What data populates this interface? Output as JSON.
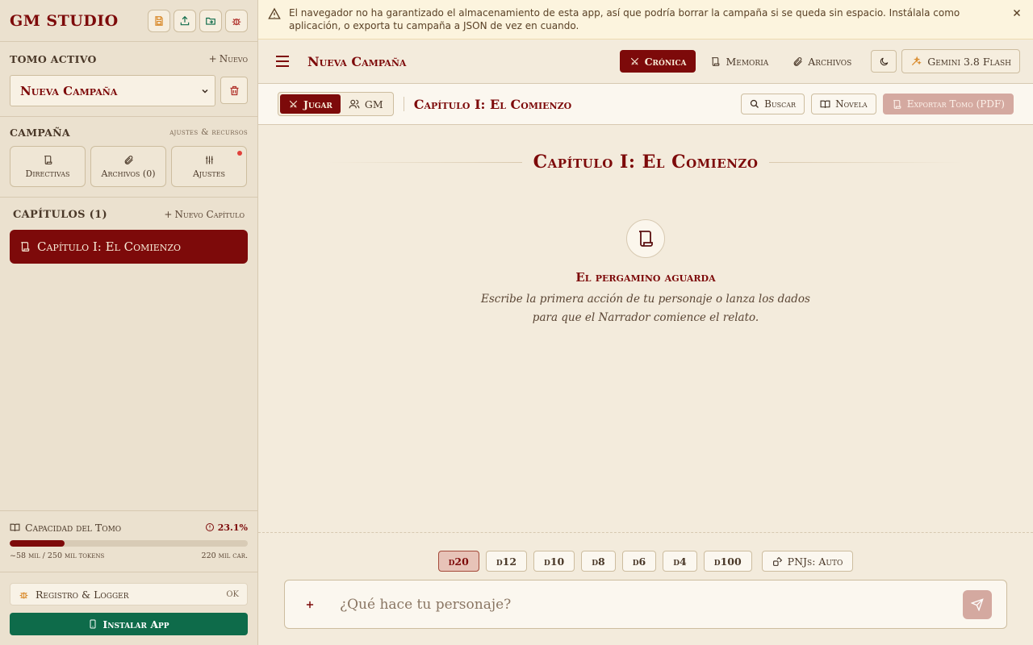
{
  "sidebar": {
    "brand": "GM STUDIO",
    "tomo_label": "TOMO ACTIVO",
    "new_label": "Nuevo",
    "tomo_selected": "Nueva Campaña",
    "campaign_label": "CAMPAÑA",
    "campaign_sub": "ajustes & recursos",
    "cards": [
      {
        "label": "Directivas",
        "icon": "scroll-icon"
      },
      {
        "label": "Archivos (0)",
        "icon": "paperclip-icon"
      },
      {
        "label": "Ajustes",
        "icon": "sliders-icon"
      }
    ],
    "chapters_label": "CAPÍTULOS (1)",
    "new_chapter_label": "Nuevo Capítulo",
    "chapters": [
      {
        "label": "Capítulo I: El Comienzo"
      }
    ],
    "capacity": {
      "label": "Capacidad del Tomo",
      "percent_label": "23.1%",
      "percent": 23.1,
      "tokens": "~58 mil / 250 mil tokens",
      "chars": "220 mil car."
    },
    "logger": {
      "label": "Registro & Logger",
      "status": "OK"
    },
    "install_label": "Instalar App"
  },
  "warning": {
    "text": "El navegador no ha garantizado el almacenamiento de esta app, así que podría borrar la campaña si se queda sin espacio. Instálala como aplicación, o exporta tu campaña a JSON de vez en cuando."
  },
  "topbar": {
    "campaign_title": "Nueva Campaña",
    "nav": [
      {
        "label": "Crónica",
        "active": true
      },
      {
        "label": "Memoria"
      },
      {
        "label": "Archivos"
      }
    ],
    "model_label": "Gemini 3.8 Flash"
  },
  "subbar": {
    "modes": [
      {
        "label": "Jugar",
        "active": true
      },
      {
        "label": "GM"
      }
    ],
    "chapter_title": "Capítulo I: El Comienzo",
    "search_label": "Buscar",
    "novel_label": "Novela",
    "export_label": "Exportar Tomo (PDF)"
  },
  "content": {
    "heading": "Capítulo I: El Comienzo",
    "empty_title": "El pergamino aguarda",
    "empty_desc": "Escribe la primera acción de tu personaje o lanza los dados para que el Narrador comience el relato."
  },
  "dice": [
    "d20",
    "d12",
    "d10",
    "d8",
    "d6",
    "d4",
    "d100"
  ],
  "pnj_label": "PNJs: Auto",
  "composer": {
    "placeholder": "¿Qué hace tu personaje?"
  },
  "colors": {
    "accent": "#7d0a0a",
    "install": "#0e6b4a",
    "background": "#f3ebdc"
  }
}
